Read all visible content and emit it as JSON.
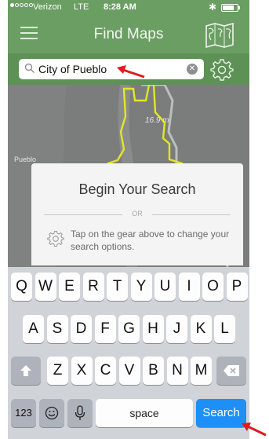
{
  "status_bar": {
    "carrier": "Verizon",
    "network": "LTE",
    "time": "8:28 AM",
    "signal_bars_filled": 1,
    "battery_level": 0.8
  },
  "nav": {
    "title": "Find Maps"
  },
  "search": {
    "value": "City of Pueblo"
  },
  "map": {
    "labels": [
      "Pueblo",
      "16.9 m"
    ]
  },
  "card": {
    "title": "Begin Your Search",
    "separator": "OR",
    "tip": "Tap on the gear above to change your search options."
  },
  "keyboard": {
    "row1": [
      "Q",
      "W",
      "E",
      "R",
      "T",
      "Y",
      "U",
      "I",
      "O",
      "P"
    ],
    "row2": [
      "A",
      "S",
      "D",
      "F",
      "G",
      "H",
      "J",
      "K",
      "L"
    ],
    "row3": [
      "Z",
      "X",
      "C",
      "V",
      "B",
      "N",
      "M"
    ],
    "numbers_key": "123",
    "space_key": "space",
    "search_key": "Search"
  },
  "colors": {
    "nav_green": "#6a9e62",
    "search_row_green": "#5d9155",
    "search_key_blue": "#1d8ff6",
    "annotation_red": "#e01c1c",
    "boundary_yellow": "#e3e626"
  },
  "icons": {
    "menu": "hamburger-icon",
    "map": "world-map-icon",
    "search": "magnifier-icon",
    "clear": "clear-icon",
    "gear": "gear-icon",
    "shift": "shift-icon",
    "backspace": "backspace-icon",
    "emoji": "emoji-icon",
    "mic": "microphone-icon"
  }
}
